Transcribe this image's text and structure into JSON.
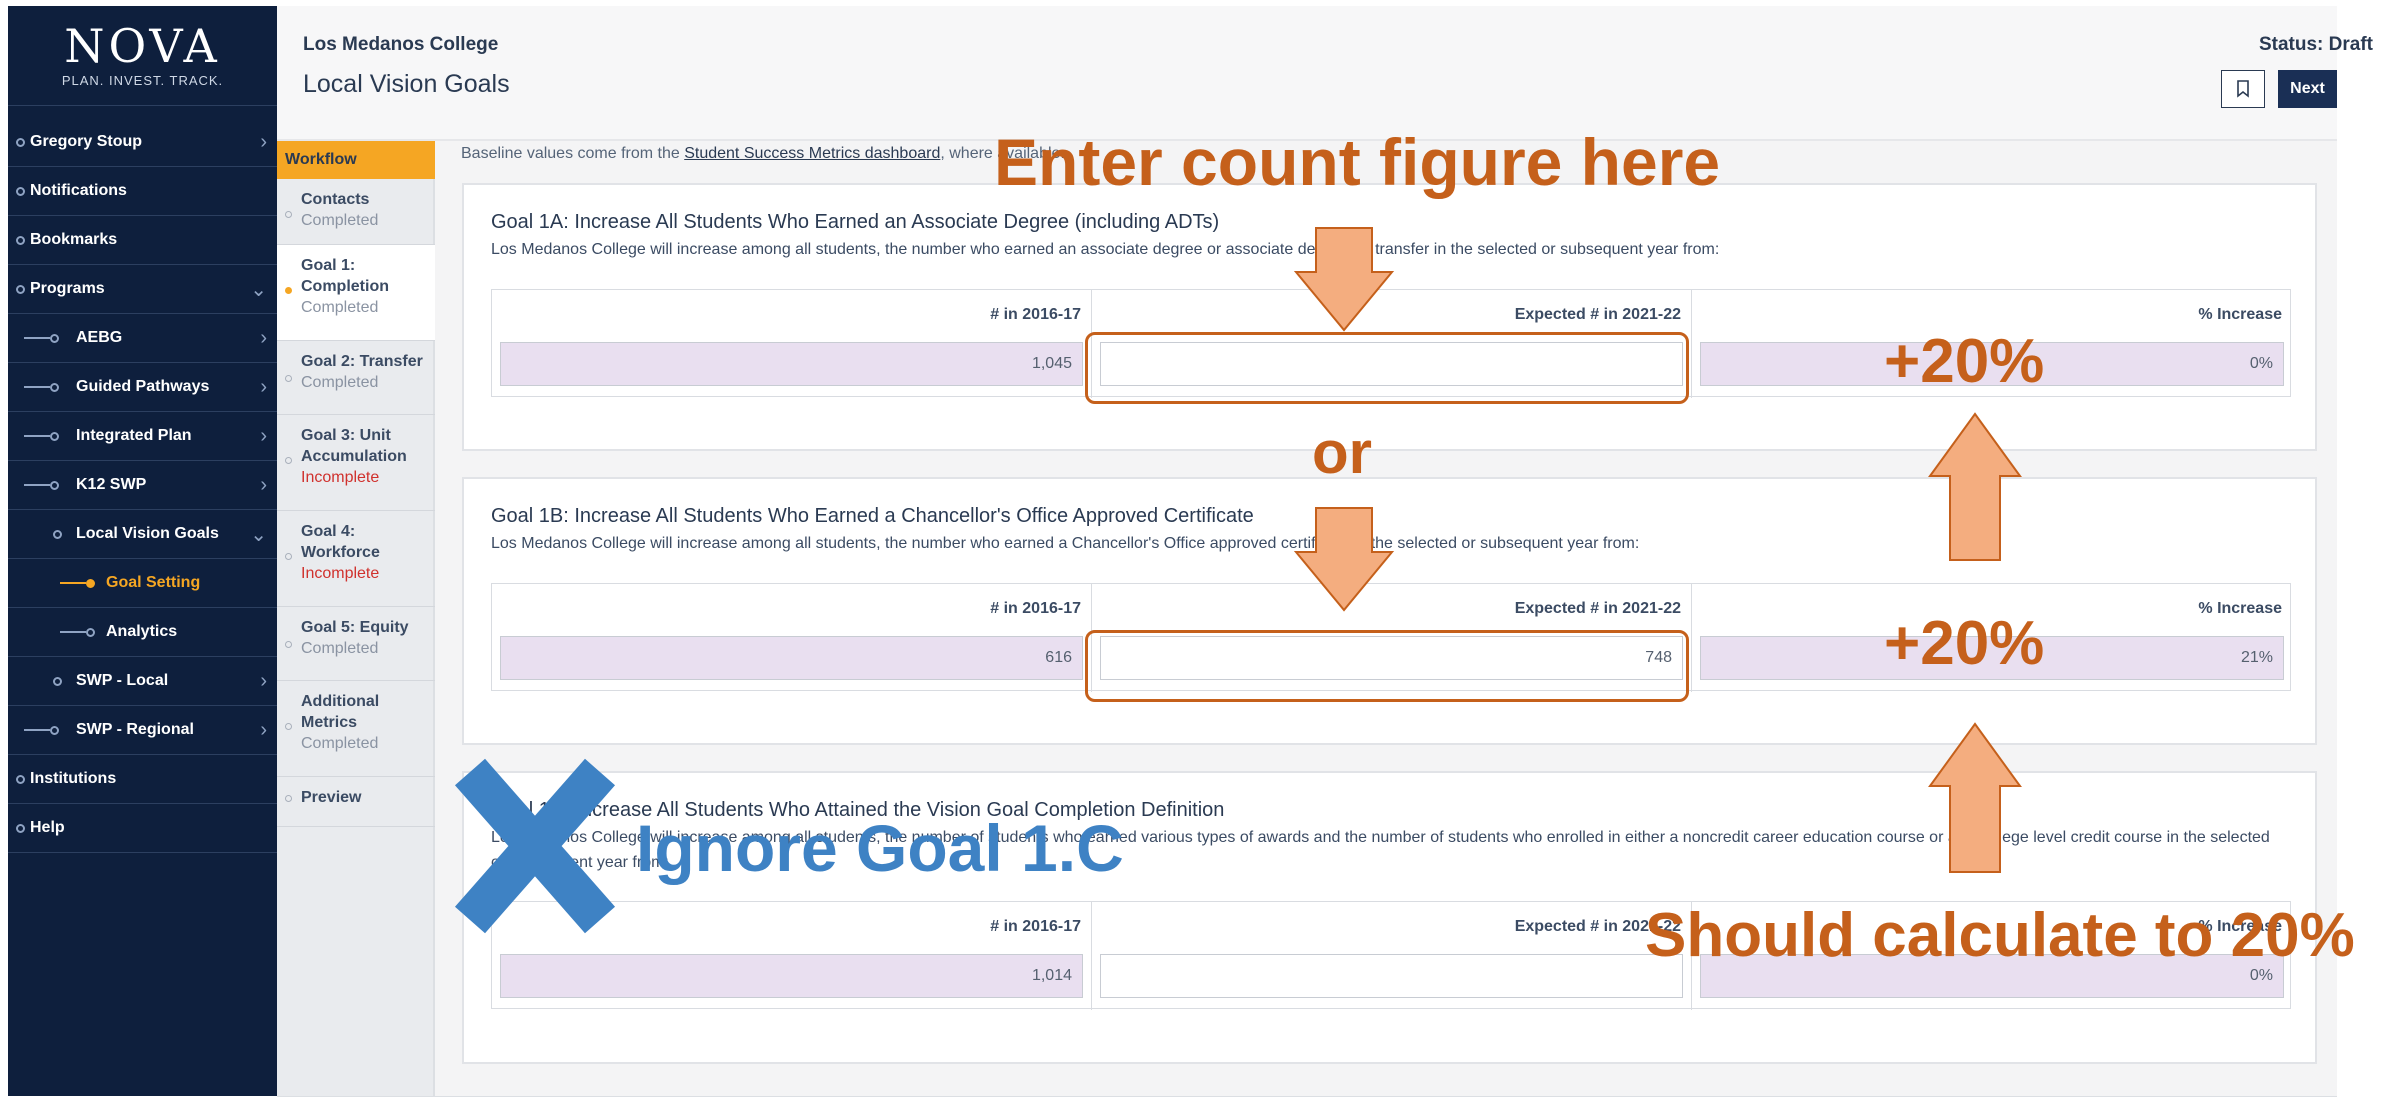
{
  "logo": {
    "word": "NOVA",
    "tagline": "PLAN. INVEST. TRACK."
  },
  "sidebar": {
    "items": [
      {
        "label": "Gregory Stoup"
      },
      {
        "label": "Notifications"
      },
      {
        "label": "Bookmarks"
      },
      {
        "label": "Programs"
      },
      {
        "label": "AEBG"
      },
      {
        "label": "Guided Pathways"
      },
      {
        "label": "Integrated Plan"
      },
      {
        "label": "K12 SWP"
      },
      {
        "label": "Local Vision Goals"
      },
      {
        "label": "Goal Setting"
      },
      {
        "label": "Analytics"
      },
      {
        "label": "SWP - Local"
      },
      {
        "label": "SWP - Regional"
      },
      {
        "label": "Institutions"
      },
      {
        "label": "Help"
      }
    ]
  },
  "header": {
    "college": "Los Medanos College",
    "title": "Local Vision Goals",
    "status": "Status: Draft",
    "next_label": "Next"
  },
  "workflow": {
    "title": "Workflow",
    "steps": [
      {
        "title": "Contacts",
        "status": "Completed"
      },
      {
        "title": "Goal 1: Completion",
        "status": "Completed"
      },
      {
        "title": "Goal 2: Transfer",
        "status": "Completed"
      },
      {
        "title": "Goal 3: Unit Accumulation",
        "status": "Incomplete"
      },
      {
        "title": "Goal 4: Workforce",
        "status": "Incomplete"
      },
      {
        "title": "Goal 5: Equity",
        "status": "Completed"
      },
      {
        "title": "Additional Metrics",
        "status": "Completed"
      },
      {
        "title": "Preview",
        "status": ""
      }
    ]
  },
  "main": {
    "baseline_prefix": "Baseline values come from the ",
    "baseline_link": "Student Success Metrics dashboard",
    "baseline_suffix": ", where available.",
    "goals": [
      {
        "title": "Goal 1A: Increase All Students Who Earned an Associate Degree (including ADTs)",
        "desc": "Los Medanos College will increase among all students, the number who earned an associate degree or associate degree for transfer in the selected or subsequent year from:",
        "col1_header": "# in 2016-17",
        "col2_header": "Expected # in 2021-22",
        "col3_header": "% Increase",
        "baseline": "1,045",
        "expected": "",
        "percent": "0%"
      },
      {
        "title": "Goal 1B: Increase All Students Who Earned a Chancellor's Office Approved Certificate",
        "desc": "Los Medanos College will increase among all students, the number who earned a Chancellor's Office approved certificate in the selected or subsequent year from:",
        "col1_header": "# in 2016-17",
        "col2_header": "Expected # in 2021-22",
        "col3_header": "% Increase",
        "baseline": "616",
        "expected": "748",
        "percent": "21%"
      },
      {
        "title": "Goal 1C: Increase All Students Who Attained the Vision Goal Completion Definition",
        "desc": "Los Medanos College will increase among all students, the number of students who earned various types of awards and the number of students who enrolled in either a noncredit career education course or any college level credit course in the selected or subsequent year from:",
        "col1_header": "# in 2016-17",
        "col2_header": "Expected # in 2021-22",
        "col3_header": "% Increase",
        "baseline": "1,014",
        "expected": "",
        "percent": "0%"
      }
    ]
  },
  "annotations": {
    "enter_count": "Enter count figure here",
    "or": "or",
    "plus20_a": "+20%",
    "plus20_b": "+20%",
    "ignore": "Ignore Goal 1.C",
    "should_calc": "Should calculate to 20%"
  },
  "colors": {
    "sidebar_bg": "#0e1f3d",
    "accent": "#f5a623",
    "annotation": "#c5601b",
    "arrow_fill": "#f4ad7f",
    "ignore_blue": "#3e82c4",
    "readonly_cell": "#e9dff0"
  }
}
